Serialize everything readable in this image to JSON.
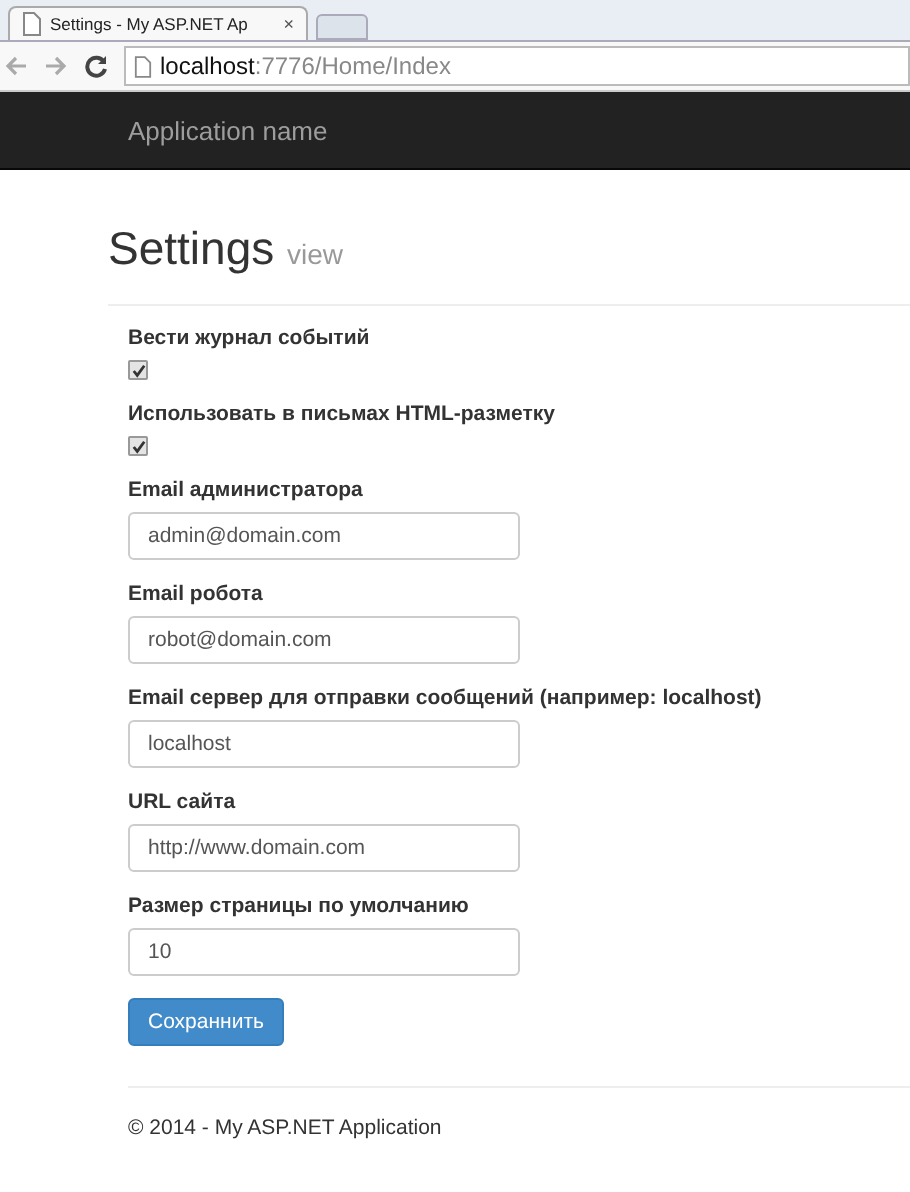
{
  "browser": {
    "tab_title": "Settings - My ASP.NET Ap",
    "tab_close": "×",
    "url_host": "localhost",
    "url_path": ":7776/Home/Index"
  },
  "navbar": {
    "brand": "Application name"
  },
  "page": {
    "title": "Settings",
    "subtitle": "view"
  },
  "fields": [
    {
      "kind": "checkbox",
      "label": "Вести журнал событий",
      "checked": true
    },
    {
      "kind": "checkbox",
      "label": "Использовать в письмах HTML-разметку",
      "checked": true
    },
    {
      "kind": "text",
      "label": "Email администратора",
      "value": "admin@domain.com"
    },
    {
      "kind": "text",
      "label": "Email робота",
      "value": "robot@domain.com"
    },
    {
      "kind": "text",
      "label": "Email сервер для отправки сообщений (например: localhost)",
      "value": "localhost"
    },
    {
      "kind": "text",
      "label": "URL сайта",
      "value": "http://www.domain.com"
    },
    {
      "kind": "text",
      "label": "Размер страницы по умолчанию",
      "value": "10"
    }
  ],
  "submit": "Сохраннить",
  "footer": "© 2014 - My ASP.NET Application"
}
